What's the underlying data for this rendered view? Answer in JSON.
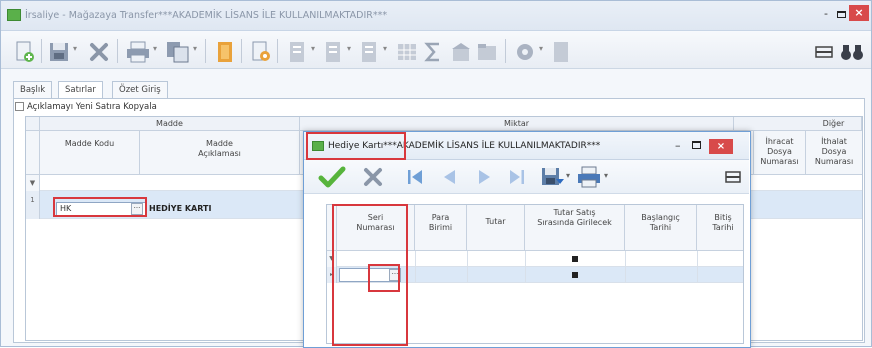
{
  "window": {
    "title": "İrsaliye - Mağazaya Transfer***AKADEMİK LİSANS İLE KULLANILMAKTADIR***",
    "minimize": "-",
    "close": "×"
  },
  "tabs": [
    {
      "label": "Başlık"
    },
    {
      "label": "Satırlar"
    },
    {
      "label": "Özet Giriş"
    }
  ],
  "copy_option": {
    "label": "Açıklamayı Yeni Satıra Kopyala"
  },
  "grid": {
    "bands": {
      "madde": "Madde",
      "miktar": "Miktar",
      "diger": "Diğer"
    },
    "columns": {
      "madde_kodu": "Madde Kodu",
      "madde_aciklamasi": "Madde Açıklaması",
      "ihracat": "İhracat Dosya Numarası",
      "ithalat": "İthalat Dosya Numarası"
    },
    "rows": [
      {
        "indicator": "▼",
        "code": "",
        "description": ""
      },
      {
        "indicator": "1",
        "code": "HK",
        "description": "HEDİYE KARTI"
      }
    ],
    "ellipsis": "···"
  },
  "dialog": {
    "title": "Hediye Kartı***AKADEMİK LİSANS İLE KULLANILMAKTADIR***",
    "minimize": "–",
    "close": "×",
    "columns": {
      "seri_numarasi": "Seri Numarası",
      "para_birimi": "Para Birimi",
      "tutar": "Tutar",
      "tutar_satis": "Tutar Satış Sırasında Girilecek",
      "baslangic": "Başlangıç Tarihi",
      "bitis": "Bitiş Tarihi"
    },
    "rows": [
      {
        "indicator": "▼"
      },
      {
        "indicator": "▸"
      }
    ],
    "ellipsis": "···"
  },
  "icons": [
    "save-check-icon",
    "cancel-x-icon",
    "first-record-icon",
    "previous-record-icon",
    "next-record-icon",
    "last-record-icon",
    "save-options-icon",
    "print-icon",
    "layout-icon",
    "gear-icon",
    "binoculars-icon",
    "sum-icon"
  ],
  "colors": {
    "accent": "#6f9fd6",
    "highlight": "#d8373d",
    "selected_row": "#dbe8f7",
    "close_button": "#d84a4a"
  }
}
